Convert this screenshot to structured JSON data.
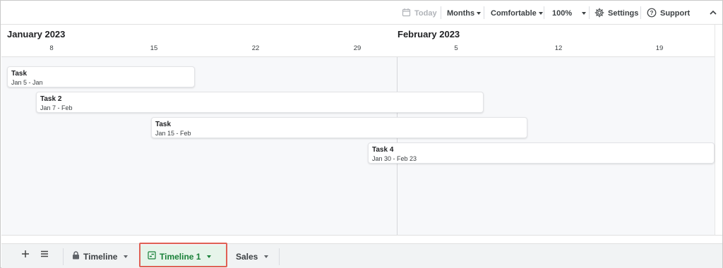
{
  "toolbar": {
    "today_label": "Today",
    "months_label": "Months",
    "density_label": "Comfortable",
    "zoom_label": "100%",
    "settings_label": "Settings",
    "support_label": "Support"
  },
  "header": {
    "months": [
      "January 2023",
      "February 2023"
    ],
    "days": [
      "8",
      "15",
      "22",
      "29",
      "5",
      "12",
      "19"
    ]
  },
  "tasks": [
    {
      "title": "Task",
      "dates": "Jan 5 - Jan"
    },
    {
      "title": "Task 2",
      "dates": "Jan 7 - Feb"
    },
    {
      "title": "Task",
      "dates": "Jan 15 - Feb"
    },
    {
      "title": "Task 4",
      "dates": "Jan 30 - Feb 23"
    }
  ],
  "sheet_tabs": [
    {
      "label": "Timeline",
      "locked": true,
      "active": false
    },
    {
      "label": "Timeline 1",
      "active": true
    },
    {
      "label": "Sales",
      "active": false
    }
  ],
  "colors": {
    "active_tab": "#188038",
    "highlight": "#e06055"
  }
}
